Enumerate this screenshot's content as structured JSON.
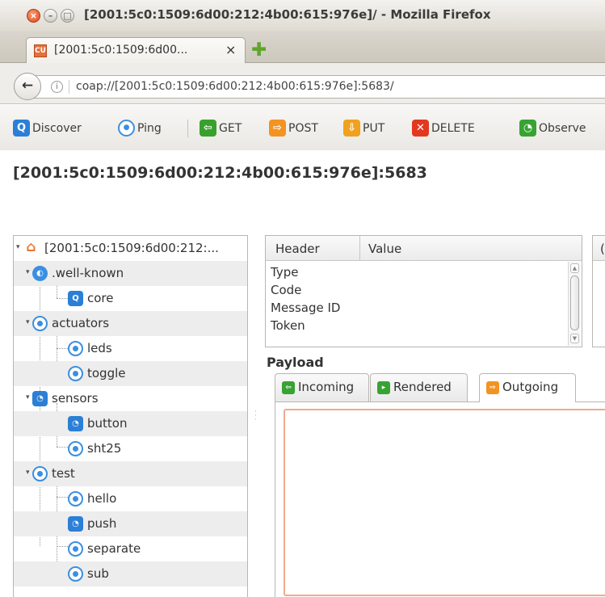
{
  "window": {
    "title": "[2001:5c0:1509:6d00:212:4b00:615:976e]/ - Mozilla Firefox",
    "close_glyph": "×",
    "min_glyph": "–",
    "max_glyph": "□"
  },
  "tab": {
    "favicon_text": "CU",
    "label": "[2001:5c0:1509:6d00...",
    "close_glyph": "×",
    "new_tab_glyph": "✚"
  },
  "navbar": {
    "back_glyph": "←",
    "info_glyph": "i",
    "url": "coap://[2001:5c0:1509:6d00:212:4b00:615:976e]:5683/"
  },
  "toolbar": {
    "discover": {
      "label": "Discover",
      "icon": "search-icon",
      "glyph": "Q"
    },
    "ping": {
      "label": "Ping",
      "icon": "ping-icon",
      "glyph": "●"
    },
    "get": {
      "label": "GET",
      "icon": "arrow-left-icon",
      "glyph": "⇦"
    },
    "post": {
      "label": "POST",
      "icon": "arrow-right-icon",
      "glyph": "⇨"
    },
    "put": {
      "label": "PUT",
      "icon": "arrow-down-icon",
      "glyph": "⇩"
    },
    "delete": {
      "label": "DELETE",
      "icon": "x-icon",
      "glyph": "✕"
    },
    "observe": {
      "label": "Observe",
      "icon": "rss-icon",
      "glyph": "◔"
    }
  },
  "heading": "[2001:5c0:1509:6d00:212:4b00:615:976e]:5683",
  "tree": {
    "toggle_open": "▾",
    "root": {
      "label": "[2001:5c0:1509:6d00:212:...",
      "glyph": "⌂"
    },
    "items": [
      {
        "label": ".well-known",
        "glyph": "◐"
      },
      {
        "label": "core",
        "glyph": "Q"
      },
      {
        "label": "actuators",
        "glyph": ""
      },
      {
        "label": "leds",
        "glyph": ""
      },
      {
        "label": "toggle",
        "glyph": ""
      },
      {
        "label": "sensors",
        "glyph": "◔"
      },
      {
        "label": "button",
        "glyph": "◔"
      },
      {
        "label": "sht25",
        "glyph": ""
      },
      {
        "label": "test",
        "glyph": ""
      },
      {
        "label": "hello",
        "glyph": ""
      },
      {
        "label": "push",
        "glyph": "◔"
      },
      {
        "label": "separate",
        "glyph": ""
      },
      {
        "label": "sub",
        "glyph": ""
      }
    ]
  },
  "headers_table": {
    "col_header": "Header",
    "col_value": "Value",
    "rows": [
      "Type",
      "Code",
      "Message ID",
      "Token"
    ],
    "right_panel_letter": "("
  },
  "payload": {
    "label": "Payload",
    "tabs": {
      "incoming": {
        "label": "Incoming",
        "glyph": "⇦"
      },
      "rendered": {
        "label": "Rendered",
        "glyph": "▸"
      },
      "outgoing": {
        "label": "Outgoing",
        "glyph": "⇨"
      }
    },
    "outgoing_text": ""
  }
}
